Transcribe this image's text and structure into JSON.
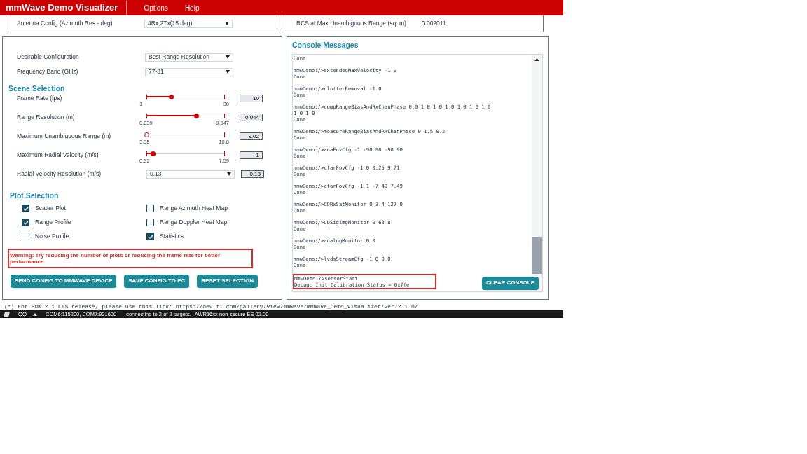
{
  "header": {
    "title": "mmWave Demo Visualizer",
    "menu": [
      "Options",
      "Help"
    ]
  },
  "top_left": {
    "label": "Antenna Config (Azimuth Res - deg)",
    "value": "4Rx,2Tx(15 deg)"
  },
  "top_right": {
    "label": "RCS at Max Unambiguous Range (sq. m)",
    "value": "0.002011"
  },
  "config": [
    {
      "label": "Desirable Configuration",
      "value": "Best Range Resolution"
    },
    {
      "label": "Frequency Band (GHz)",
      "value": "77-81"
    }
  ],
  "scene_selection": {
    "title": "Scene Selection",
    "rows": [
      {
        "kind": "slider",
        "label": "Frame Rate (fps)",
        "min": "1",
        "max": "30",
        "level": 0.31,
        "value": "10"
      },
      {
        "kind": "slider",
        "label": "Range Resolution (m)",
        "min": "0.039",
        "max": "0.047",
        "level": 0.63,
        "value": "0.044"
      },
      {
        "kind": "slider",
        "label": "Maximum Unambiguous Range (m)",
        "min": "3.95",
        "max": "10.8",
        "level": 0.0,
        "value": "9.02"
      },
      {
        "kind": "slider",
        "label": "Maximum Radial Velocity (m/s)",
        "min": "0.32",
        "max": "7.59",
        "level": 0.08,
        "value": "1"
      },
      {
        "kind": "select",
        "label": "Radial Velocity Resolution (m/s)",
        "option": "0.13",
        "value": "0.13"
      }
    ]
  },
  "plot_selection": {
    "title": "Plot Selection",
    "items": [
      {
        "label": "Scatter Plot",
        "checked": true
      },
      {
        "label": "Range Azimuth Heat Map",
        "checked": false
      },
      {
        "label": "Range Profile",
        "checked": true
      },
      {
        "label": "Range Doppler Heat Map",
        "checked": false
      },
      {
        "label": "Noise Profile",
        "checked": false
      },
      {
        "label": "Statistics",
        "checked": true
      }
    ]
  },
  "warning": "Warning: Try reducing the number of plots or reducing the frame rate for better performance",
  "buttons": [
    "SEND CONFIG TO MMWAVE DEVICE",
    "SAVE CONFIG TO PC",
    "RESET SELECTION"
  ],
  "console": {
    "title": "Console Messages",
    "entries": [
      {
        "lines": [
          "Done"
        ],
        "highlighted": false
      },
      {
        "lines": [
          "mmwDemo:/>extendedMaxVelocity -1 0",
          "Done"
        ],
        "highlighted": false
      },
      {
        "lines": [
          "mmwDemo:/>clutterRemoval -1 0",
          "Done"
        ],
        "highlighted": false
      },
      {
        "lines": [
          "mmwDemo:/>compRangeBiasAndRxChanPhase 0.0 1 0 1 0 1 0 1 0 1 0 1 0",
          "1 0 1 0",
          "Done"
        ],
        "highlighted": false
      },
      {
        "lines": [
          "mmwDemo:/>measureRangeBiasAndRxChanPhase 0 1.5 0.2",
          "Done"
        ],
        "highlighted": false
      },
      {
        "lines": [
          "mmwDemo:/>aoaFovCfg -1 -90 90 -90 90",
          "Done"
        ],
        "highlighted": false
      },
      {
        "lines": [
          "mmwDemo:/>cfarFovCfg -1 0 0.25 9.71",
          "Done"
        ],
        "highlighted": false
      },
      {
        "lines": [
          "mmwDemo:/>cfarFovCfg -1 1 -7.49 7.49",
          "Done"
        ],
        "highlighted": false
      },
      {
        "lines": [
          "mmwDemo:/>CQRxSatMonitor 0 3 4 127 0",
          "Done"
        ],
        "highlighted": false
      },
      {
        "lines": [
          "mmwDemo:/>CQSigImgMonitor 0 63 8",
          "Done"
        ],
        "highlighted": false
      },
      {
        "lines": [
          "mmwDemo:/>analogMonitor 0 0",
          "Done"
        ],
        "highlighted": false
      },
      {
        "lines": [
          "mmwDemo:/>lvdsStreamCfg -1 0 0 0",
          "Done"
        ],
        "highlighted": false
      },
      {
        "lines": [
          "mmwDemo:/>sensorStart",
          "Debug: Init Calibration Status = 0x7fe"
        ],
        "highlighted": true
      }
    ],
    "clear_button": "CLEAR CONSOLE"
  },
  "footer_note": "(*) For SDK 2.1 LTS release, please use this link: https://dev.ti.com/gallery/view/mmwave/mmWave_Demo_Visualizer/ver/2.1.0/",
  "status_bar": {
    "ports": "COM6:115200, COM7:921600",
    "status": "connecting to 2 of 2 targets.",
    "device": "AWR16xx non-secure ES 02.00"
  }
}
